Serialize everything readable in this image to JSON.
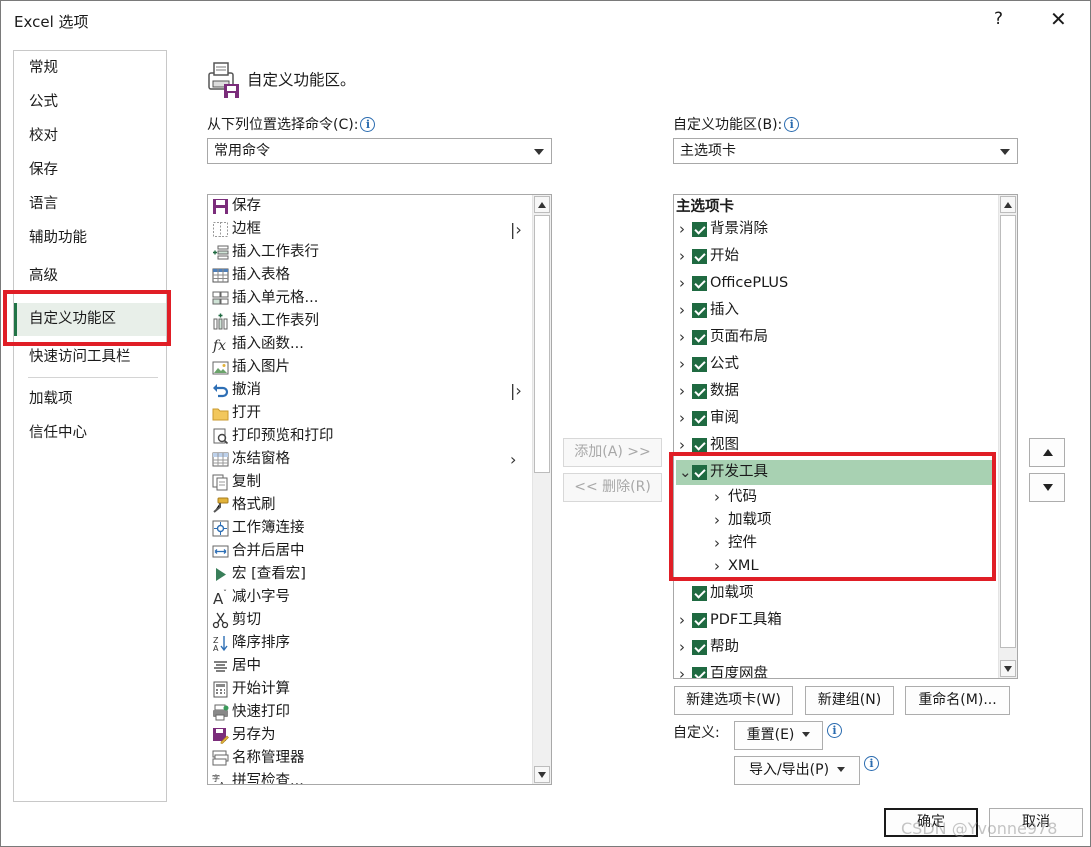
{
  "window": {
    "title": "Excel 选项",
    "help": "?",
    "close": "✕"
  },
  "nav": {
    "items": [
      "常规",
      "公式",
      "校对",
      "保存",
      "语言",
      "辅助功能",
      "高级",
      "自定义功能区",
      "快速访问工具栏",
      "加载项",
      "信任中心"
    ],
    "selected": "自定义功能区"
  },
  "section": {
    "title": "自定义功能区。"
  },
  "left": {
    "label": "从下列位置选择命令(C):",
    "select_value": "常用命令",
    "commands": [
      {
        "icon": "save-icon",
        "label": "保存"
      },
      {
        "icon": "border-icon",
        "label": "边框",
        "submenu": true
      },
      {
        "icon": "insert-row-icon",
        "label": "插入工作表行"
      },
      {
        "icon": "table-icon",
        "label": "插入表格"
      },
      {
        "icon": "insert-cells-icon",
        "label": "插入单元格..."
      },
      {
        "icon": "insert-column-icon",
        "label": "插入工作表列"
      },
      {
        "icon": "function-icon",
        "label": "插入函数..."
      },
      {
        "icon": "picture-icon",
        "label": "插入图片"
      },
      {
        "icon": "undo-icon",
        "label": "撤消",
        "submenu": true
      },
      {
        "icon": "folder-icon",
        "label": "打开"
      },
      {
        "icon": "print-preview-icon",
        "label": "打印预览和打印"
      },
      {
        "icon": "freeze-panes-icon",
        "label": "冻结窗格",
        "submenu": true
      },
      {
        "icon": "copy-icon",
        "label": "复制"
      },
      {
        "icon": "format-painter-icon",
        "label": "格式刷"
      },
      {
        "icon": "workbook-link-icon",
        "label": "工作簿连接"
      },
      {
        "icon": "merge-center-icon",
        "label": "合并后居中"
      },
      {
        "icon": "macro-icon",
        "label": "宏 [查看宏]"
      },
      {
        "icon": "decrease-font-icon",
        "label": "减小字号"
      },
      {
        "icon": "cut-icon",
        "label": "剪切"
      },
      {
        "icon": "sort-desc-icon",
        "label": "降序排序"
      },
      {
        "icon": "align-center-icon",
        "label": "居中"
      },
      {
        "icon": "calculate-icon",
        "label": "开始计算"
      },
      {
        "icon": "quick-print-icon",
        "label": "快速打印"
      },
      {
        "icon": "save-as-icon",
        "label": "另存为"
      },
      {
        "icon": "name-manager-icon",
        "label": "名称管理器"
      },
      {
        "icon": "spelling-icon",
        "label": "拼写检查..."
      }
    ]
  },
  "middle": {
    "add": "添加(A) >>",
    "remove": "<< 删除(R)"
  },
  "right": {
    "label": "自定义功能区(B):",
    "select_value": "主选项卡",
    "header": "主选项卡",
    "tabs": [
      {
        "label": "背景消除",
        "expand": "collapsed",
        "checked": true
      },
      {
        "label": "开始",
        "expand": "collapsed",
        "checked": true
      },
      {
        "label": "OfficePLUS",
        "expand": "collapsed",
        "checked": true
      },
      {
        "label": "插入",
        "expand": "collapsed",
        "checked": true
      },
      {
        "label": "页面布局",
        "expand": "collapsed",
        "checked": true
      },
      {
        "label": "公式",
        "expand": "collapsed",
        "checked": true
      },
      {
        "label": "数据",
        "expand": "collapsed",
        "checked": true
      },
      {
        "label": "审阅",
        "expand": "collapsed",
        "checked": true
      },
      {
        "label": "视图",
        "expand": "collapsed",
        "checked": true
      },
      {
        "label": "开发工具",
        "expand": "expanded",
        "checked": true,
        "selected": true,
        "groups": [
          "代码",
          "加载项",
          "控件",
          "XML"
        ]
      },
      {
        "label": "加载项",
        "expand": "none",
        "checked": true
      },
      {
        "label": "PDF工具箱",
        "expand": "collapsed",
        "checked": true
      },
      {
        "label": "帮助",
        "expand": "collapsed",
        "checked": true
      },
      {
        "label": "百度网盘",
        "expand": "collapsed",
        "checked": true
      }
    ],
    "new_tab": "新建选项卡(W)",
    "new_group": "新建组(N)",
    "rename": "重命名(M)...",
    "customize_label": "自定义:",
    "reset": "重置(E)",
    "import_export": "导入/导出(P)"
  },
  "footer": {
    "ok": "确定",
    "cancel": "取消"
  },
  "watermark": "CSDN @Yvonne978",
  "colors": {
    "accent": "#217346",
    "highlight": "#a8d1b2",
    "annotation_red": "#e01e26"
  }
}
